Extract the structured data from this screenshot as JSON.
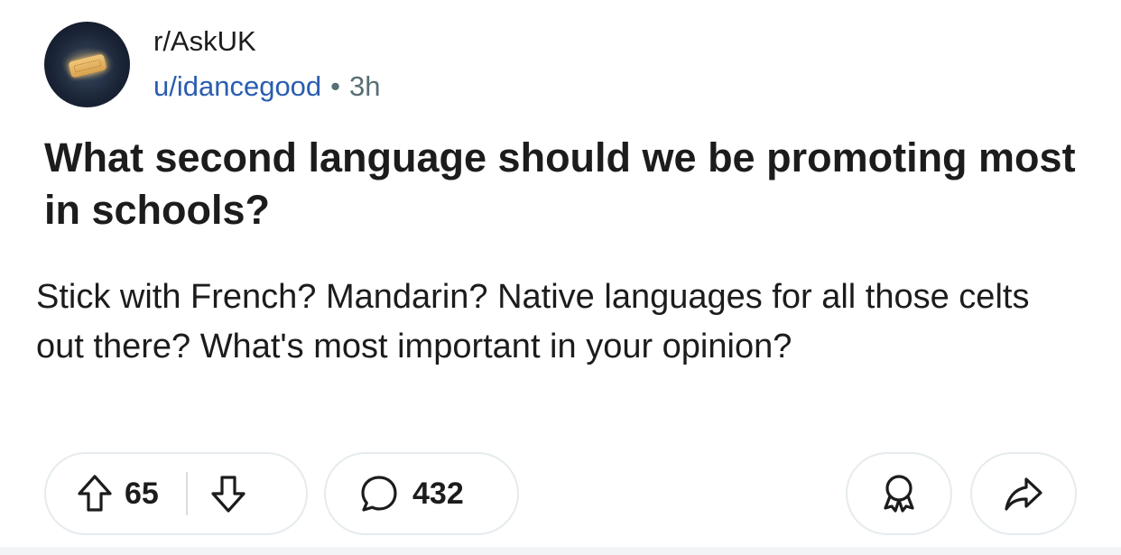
{
  "post": {
    "subreddit": "r/AskUK",
    "author": "u/idancegood",
    "separator": "•",
    "time_ago": "3h",
    "title": "What second language should we be promoting most in schools?",
    "body": "Stick with French? Mandarin? Native languages for all those celts out there? What's most important in your opinion?"
  },
  "actions": {
    "upvote_icon": "arrow-up-icon",
    "vote_count": "65",
    "downvote_icon": "arrow-down-icon",
    "comment_icon": "comment-bubble-icon",
    "comment_count": "432",
    "award_icon": "award-icon",
    "share_icon": "share-icon"
  },
  "colors": {
    "author_link": "#2a5db0",
    "meta_text": "#576f76",
    "pill_border": "#e5ebee"
  }
}
